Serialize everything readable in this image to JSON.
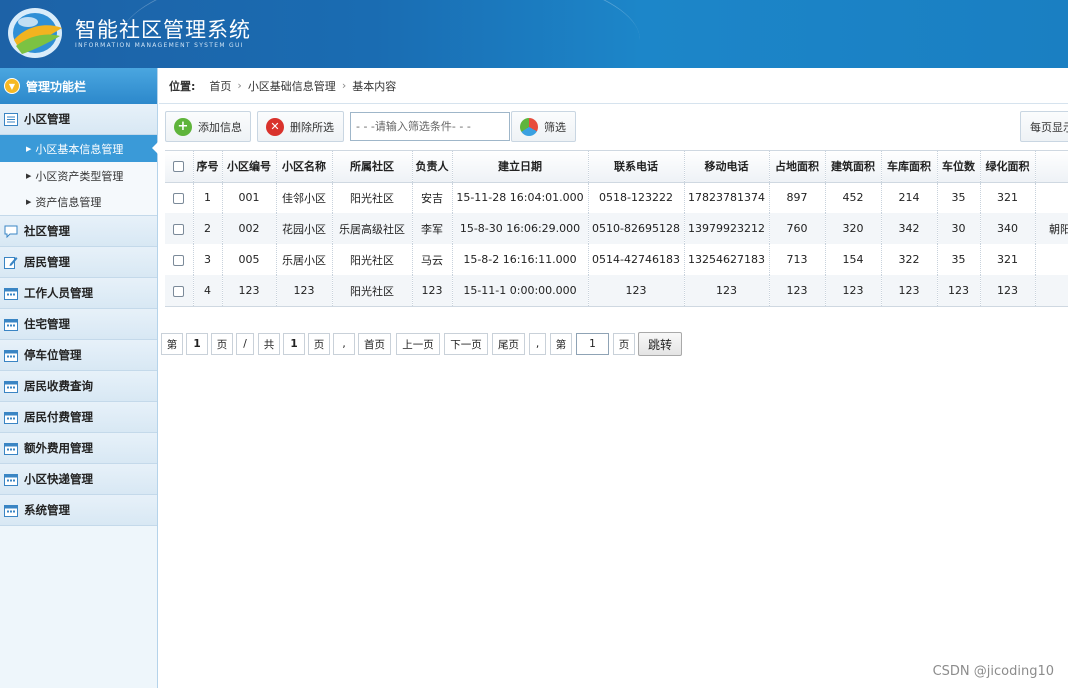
{
  "header": {
    "title": "智能社区管理系统",
    "subtitle": "INFORMATION MANAGEMENT SYSTEM GUI"
  },
  "sidebar": {
    "title": "管理功能栏",
    "groups": [
      {
        "label": "小区管理",
        "icon": "list-icon",
        "items": [
          "小区基本信息管理",
          "小区资产类型管理",
          "资产信息管理"
        ]
      },
      {
        "label": "社区管理",
        "icon": "chat-icon"
      },
      {
        "label": "居民管理",
        "icon": "edit-icon"
      },
      {
        "label": "工作人员管理",
        "icon": "calendar-icon"
      },
      {
        "label": "住宅管理",
        "icon": "calendar-icon"
      },
      {
        "label": "停车位管理",
        "icon": "calendar-icon"
      },
      {
        "label": "居民收费查询",
        "icon": "calendar-icon"
      },
      {
        "label": "居民付费管理",
        "icon": "calendar-icon"
      },
      {
        "label": "额外费用管理",
        "icon": "calendar-icon"
      },
      {
        "label": "小区快递管理",
        "icon": "calendar-icon"
      },
      {
        "label": "系统管理",
        "icon": "calendar-icon"
      }
    ]
  },
  "breadcrumb": {
    "label": "位置:",
    "items": [
      "首页",
      "小区基础信息管理",
      "基本内容"
    ]
  },
  "toolbar": {
    "add_label": "添加信息",
    "delete_label": "删除所选",
    "search_placeholder": "- - -请输入筛选条件- - -",
    "filter_label": "筛选",
    "page_size_label": "每页显示"
  },
  "table": {
    "columns": [
      "序号",
      "小区编号",
      "小区名称",
      "所属社区",
      "负责人",
      "建立日期",
      "联系电话",
      "移动电话",
      "占地面积",
      "建筑面积",
      "车库面积",
      "车位数",
      "绿化面积",
      ""
    ],
    "rows": [
      [
        "1",
        "001",
        "佳邻小区",
        "阳光社区",
        "安吉",
        "15-11-28 16:04:01.000",
        "0518-123222",
        "17823781374",
        "897",
        "452",
        "214",
        "35",
        "321",
        ""
      ],
      [
        "2",
        "002",
        "花园小区",
        "乐居高级社区",
        "李军",
        "15-8-30 16:06:29.000",
        "0510-82695128",
        "13979923212",
        "760",
        "320",
        "342",
        "30",
        "340",
        "朝阳"
      ],
      [
        "3",
        "005",
        "乐居小区",
        "阳光社区",
        "马云",
        "15-8-2 16:16:11.000",
        "0514-42746183",
        "13254627183",
        "713",
        "154",
        "322",
        "35",
        "321",
        ""
      ],
      [
        "4",
        "123",
        "123",
        "阳光社区",
        "123",
        "15-11-1 0:00:00.000",
        "123",
        "123",
        "123",
        "123",
        "123",
        "123",
        "123",
        ""
      ]
    ]
  },
  "pager": {
    "di": "第",
    "current": "1",
    "ye": "页",
    "slash": "/",
    "gong": "共",
    "total": "1",
    "ye2": "页",
    "comma": ",",
    "first": "首页",
    "prev": "上一页",
    "next": "下一页",
    "last": "尾页",
    "comma2": ",",
    "di2": "第",
    "goto_value": "1",
    "ye3": "页",
    "jump": "跳转"
  },
  "watermark": "CSDN @jicoding10"
}
